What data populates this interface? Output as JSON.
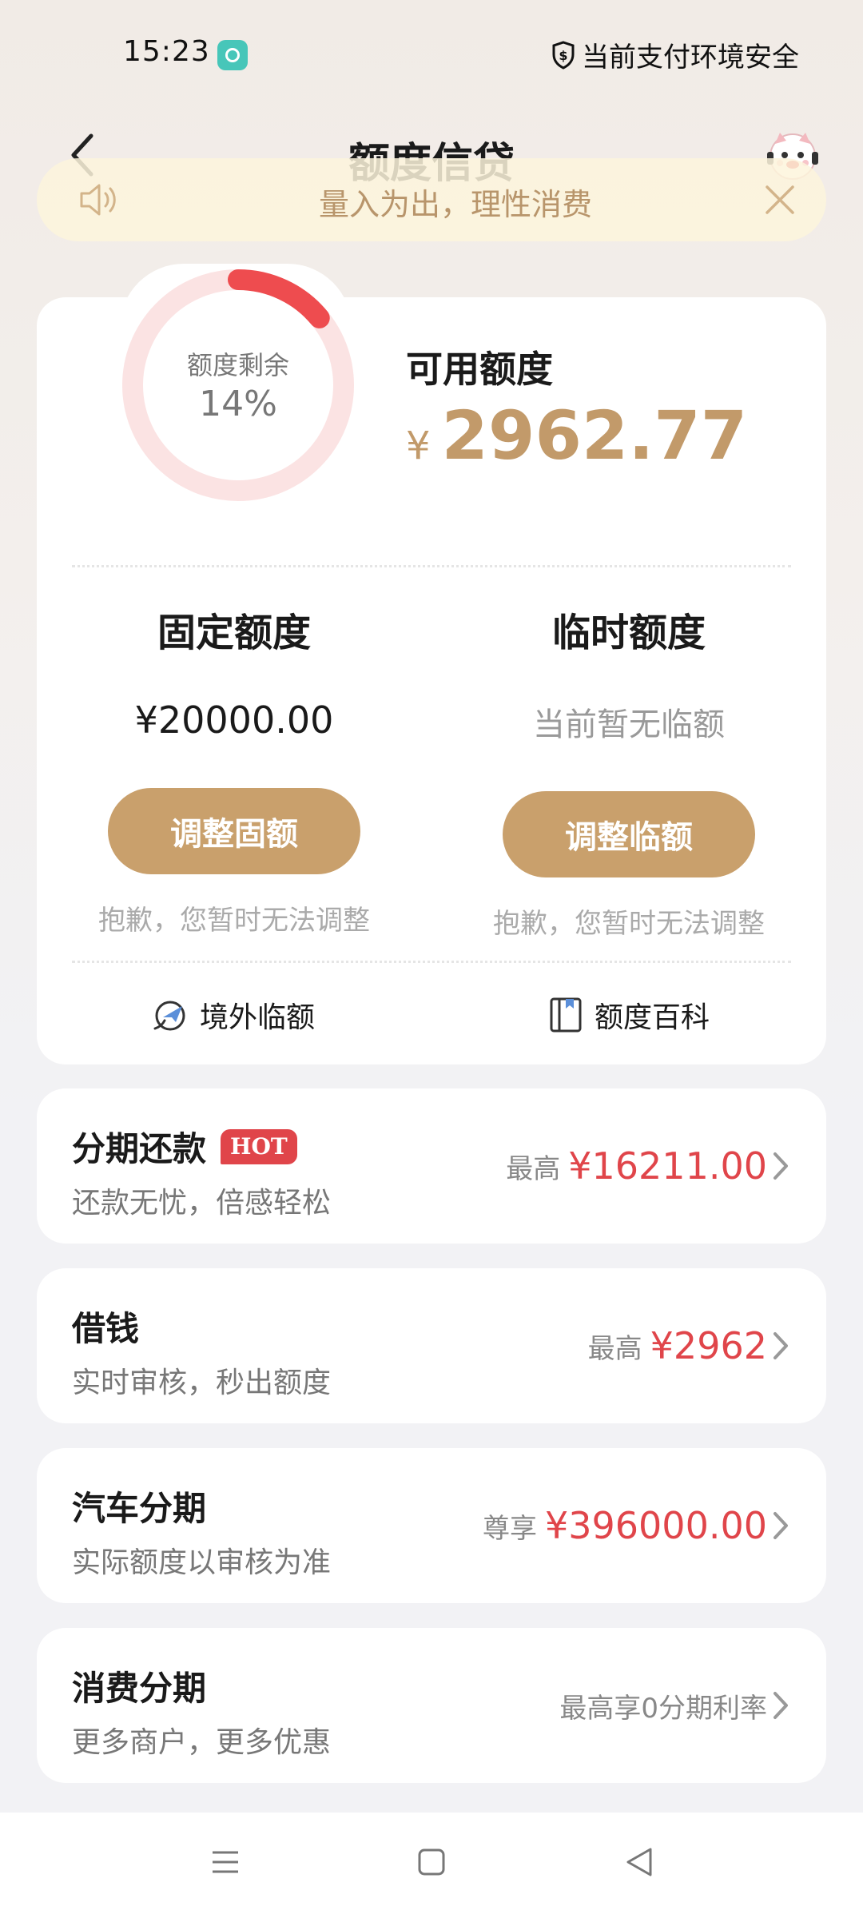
{
  "status_bar": {
    "time": "15:23",
    "security_text": "当前支付环境安全"
  },
  "nav": {
    "title": "额度信贷"
  },
  "notice": {
    "text": "量入为出，理性消费"
  },
  "credit": {
    "ring_label": "额度剩余",
    "ring_percent_text": "14%",
    "ring_fraction": 0.14,
    "available_label": "可用额度",
    "available_currency": "¥",
    "available_amount": "2962.77",
    "fixed": {
      "title": "固定额度",
      "value": "¥20000.00",
      "button": "调整固额",
      "note": "抱歉，您暂时无法调整"
    },
    "temporary": {
      "title": "临时额度",
      "value": "当前暂无临额",
      "button": "调整临额",
      "note": "抱歉，您暂时无法调整"
    },
    "links": {
      "overseas": "境外临额",
      "wiki": "额度百科"
    }
  },
  "products": [
    {
      "title": "分期还款",
      "badge": "HOT",
      "subtitle": "还款无忧，倍感轻松",
      "prefix": "最高",
      "amount": "¥16211.00"
    },
    {
      "title": "借钱",
      "subtitle": "实时审核，秒出额度",
      "prefix": "最高",
      "amount": "¥2962"
    },
    {
      "title": "汽车分期",
      "subtitle": "实际额度以审核为准",
      "prefix": "尊享",
      "amount": "¥396000.00"
    },
    {
      "title": "消费分期",
      "subtitle": "更多商户，更多优惠",
      "plain": "最高享0分期利率"
    }
  ],
  "colors": {
    "accent_gold": "#c9a06c",
    "amount_red": "#e0454a",
    "ring_track": "#fbe3e3",
    "ring_fill": "#ee4c4f"
  },
  "icons": [
    "app-notification-icon",
    "shield-icon",
    "back-icon",
    "mascot-icon",
    "speaker-icon",
    "close-icon",
    "plane-globe-icon",
    "book-icon",
    "chevron-right-icon",
    "menu-icon",
    "home-icon",
    "back-triangle-icon"
  ]
}
